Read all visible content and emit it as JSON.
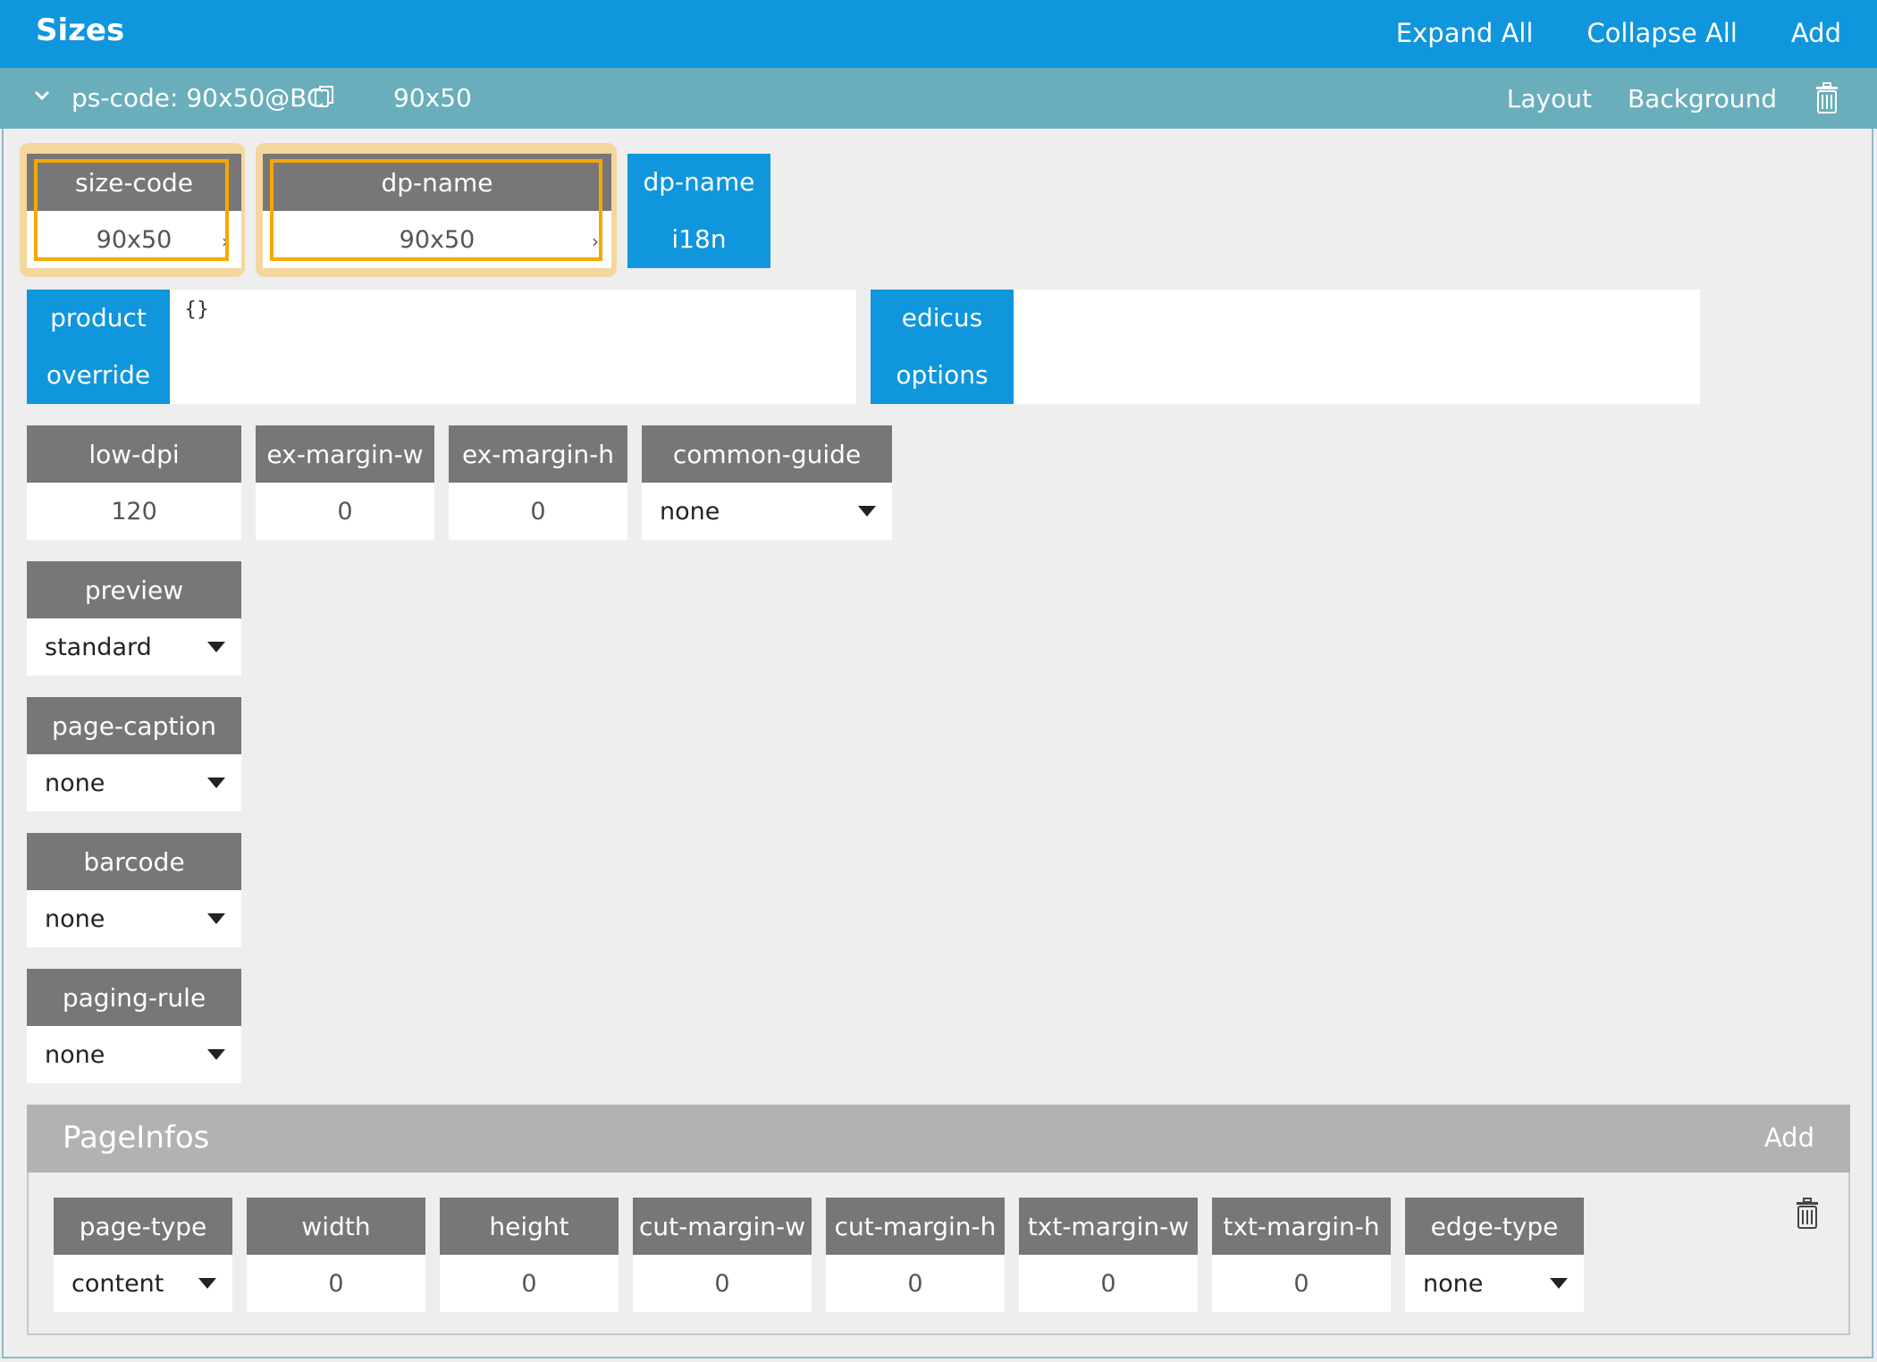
{
  "header": {
    "title": "Sizes",
    "expand_all": "Expand All",
    "collapse_all": "Collapse All",
    "add": "Add"
  },
  "item": {
    "code": "ps-code: 90x50@BC",
    "value": "90x50",
    "layout": "Layout",
    "background": "Background"
  },
  "fields": {
    "size_code": {
      "label": "size-code",
      "value": "90x50"
    },
    "dp_name": {
      "label": "dp-name",
      "value": "90x50"
    },
    "dp_name_i18n": {
      "line1": "dp-name",
      "line2": "i18n"
    },
    "product_override": {
      "line1": "product",
      "line2": "override",
      "value": "{}"
    },
    "edicus_options": {
      "line1": "edicus",
      "line2": "options",
      "value": ""
    },
    "low_dpi": {
      "label": "low-dpi",
      "value": "120"
    },
    "ex_margin_w": {
      "label": "ex-margin-w",
      "value": "0"
    },
    "ex_margin_h": {
      "label": "ex-margin-h",
      "value": "0"
    },
    "common_guide": {
      "label": "common-guide",
      "value": "none"
    },
    "preview": {
      "label": "preview",
      "value": "standard"
    },
    "page_caption": {
      "label": "page-caption",
      "value": "none"
    },
    "barcode": {
      "label": "barcode",
      "value": "none"
    },
    "paging_rule": {
      "label": "paging-rule",
      "value": "none"
    }
  },
  "pageinfos": {
    "title": "PageInfos",
    "add": "Add",
    "page_type": {
      "label": "page-type",
      "value": "content"
    },
    "width": {
      "label": "width",
      "value": "0"
    },
    "height": {
      "label": "height",
      "value": "0"
    },
    "cut_margin_w": {
      "label": "cut-margin-w",
      "value": "0"
    },
    "cut_margin_h": {
      "label": "cut-margin-h",
      "value": "0"
    },
    "txt_margin_w": {
      "label": "txt-margin-w",
      "value": "0"
    },
    "txt_margin_h": {
      "label": "txt-margin-h",
      "value": "0"
    },
    "edge_type": {
      "label": "edge-type",
      "value": "none"
    }
  },
  "colors": {
    "header_blue": "#0f96dc",
    "item_teal": "#6aaebb",
    "label_gray": "#777777",
    "highlight_orange": "#f5a800"
  },
  "icons": {
    "chevron": "chevron-down-icon",
    "copy": "copy-icon",
    "trash": "trash-icon",
    "caret": "caret-down-icon"
  }
}
